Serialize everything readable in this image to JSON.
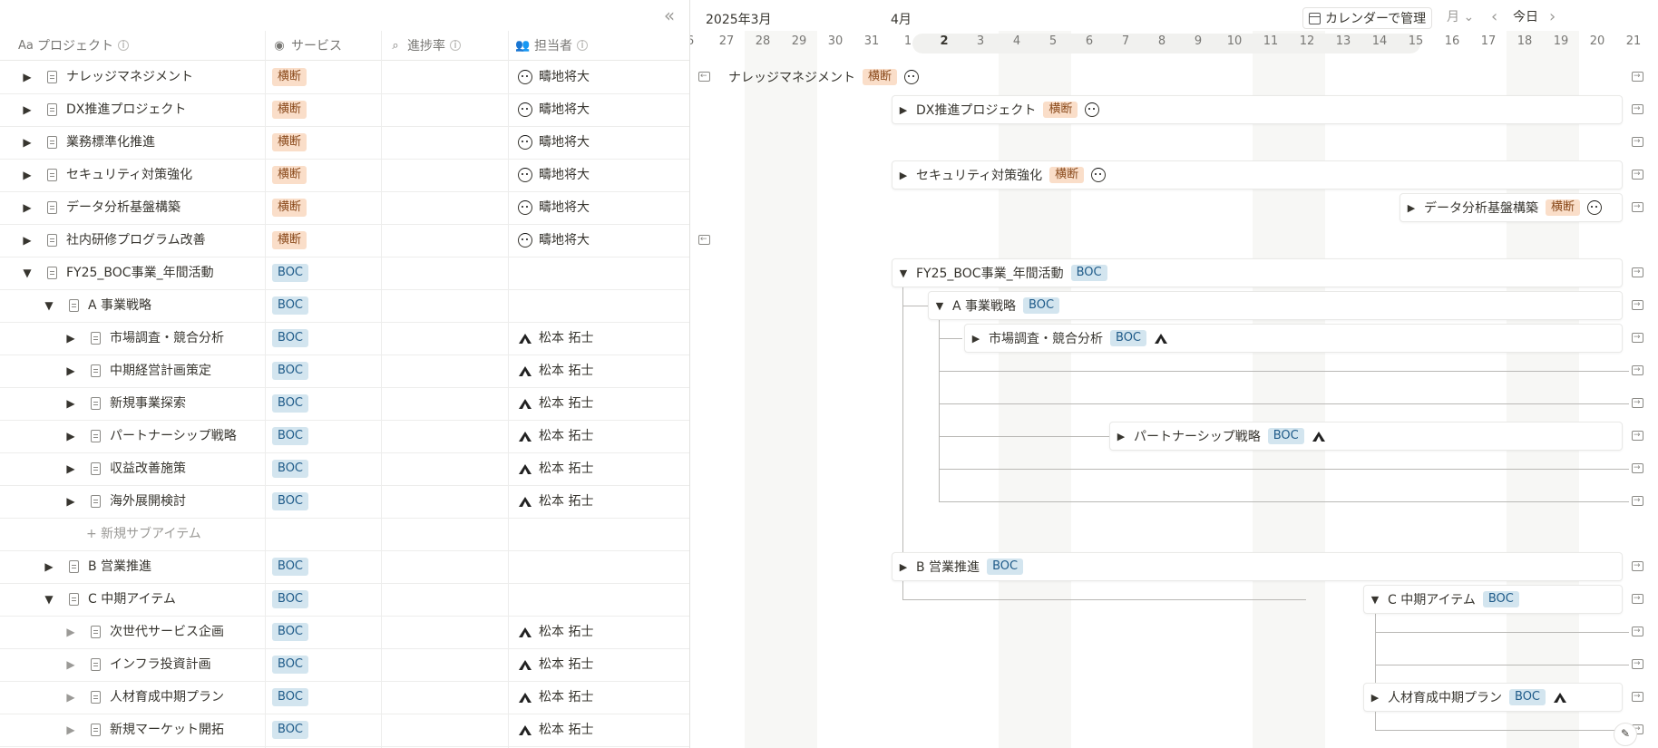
{
  "table": {
    "collapse_icon": "double-chevron-left-icon",
    "columns": [
      {
        "label": "プロジェクト",
        "icon": "Aa"
      },
      {
        "label": "サービス",
        "icon": "◉"
      },
      {
        "label": "進捗率",
        "icon": "⌕"
      },
      {
        "label": "担当者",
        "icon": "👥"
      }
    ],
    "rows": [
      {
        "title": "ナレッジマネジメント",
        "tag": "横断",
        "tag_type": "yokodan",
        "owner": "疇地将大",
        "avatar": "face",
        "depth": 0,
        "toggle": "▶"
      },
      {
        "title": "DX推進プロジェクト",
        "tag": "横断",
        "tag_type": "yokodan",
        "owner": "疇地将大",
        "avatar": "face",
        "depth": 0,
        "toggle": "▶"
      },
      {
        "title": "業務標準化推進",
        "tag": "横断",
        "tag_type": "yokodan",
        "owner": "疇地将大",
        "avatar": "face",
        "depth": 0,
        "toggle": "▶"
      },
      {
        "title": "セキュリティ対策強化",
        "tag": "横断",
        "tag_type": "yokodan",
        "owner": "疇地将大",
        "avatar": "face",
        "depth": 0,
        "toggle": "▶"
      },
      {
        "title": "データ分析基盤構築",
        "tag": "横断",
        "tag_type": "yokodan",
        "owner": "疇地将大",
        "avatar": "face",
        "depth": 0,
        "toggle": "▶"
      },
      {
        "title": "社内研修プログラム改善",
        "tag": "横断",
        "tag_type": "yokodan",
        "owner": "疇地将大",
        "avatar": "face",
        "depth": 0,
        "toggle": "▶"
      },
      {
        "title": "FY25_BOC事業_年間活動",
        "tag": "BOC",
        "tag_type": "boc",
        "owner": "",
        "avatar": "",
        "depth": 0,
        "toggle": "▼"
      },
      {
        "title": "A 事業戦略",
        "tag": "BOC",
        "tag_type": "boc",
        "owner": "",
        "avatar": "",
        "depth": 1,
        "toggle": "▼"
      },
      {
        "title": "市場調査・競合分析",
        "tag": "BOC",
        "tag_type": "boc",
        "owner": "松本 拓士",
        "avatar": "mtn",
        "depth": 2,
        "toggle": "▶"
      },
      {
        "title": "中期経営計画策定",
        "tag": "BOC",
        "tag_type": "boc",
        "owner": "松本 拓士",
        "avatar": "mtn",
        "depth": 2,
        "toggle": "▶"
      },
      {
        "title": "新規事業探索",
        "tag": "BOC",
        "tag_type": "boc",
        "owner": "松本 拓士",
        "avatar": "mtn",
        "depth": 2,
        "toggle": "▶"
      },
      {
        "title": "パートナーシップ戦略",
        "tag": "BOC",
        "tag_type": "boc",
        "owner": "松本 拓士",
        "avatar": "mtn",
        "depth": 2,
        "toggle": "▶"
      },
      {
        "title": "収益改善施策",
        "tag": "BOC",
        "tag_type": "boc",
        "owner": "松本 拓士",
        "avatar": "mtn",
        "depth": 2,
        "toggle": "▶"
      },
      {
        "title": "海外展開検討",
        "tag": "BOC",
        "tag_type": "boc",
        "owner": "松本 拓士",
        "avatar": "mtn",
        "depth": 2,
        "toggle": "▶"
      },
      {
        "new_sub": "+ 新規サブアイテム"
      },
      {
        "title": "B 営業推進",
        "tag": "BOC",
        "tag_type": "boc",
        "owner": "",
        "avatar": "",
        "depth": 1,
        "toggle": "▶"
      },
      {
        "title": "C 中期アイテム",
        "tag": "BOC",
        "tag_type": "boc",
        "owner": "",
        "avatar": "",
        "depth": 1,
        "toggle": "▼"
      },
      {
        "title": "次世代サービス企画",
        "tag": "BOC",
        "tag_type": "boc",
        "owner": "松本 拓士",
        "avatar": "mtn",
        "depth": 2,
        "toggle": "▶",
        "light": true
      },
      {
        "title": "インフラ投資計画",
        "tag": "BOC",
        "tag_type": "boc",
        "owner": "松本 拓士",
        "avatar": "mtn",
        "depth": 2,
        "toggle": "▶",
        "light": true
      },
      {
        "title": "人材育成中期プラン",
        "tag": "BOC",
        "tag_type": "boc",
        "owner": "松本 拓士",
        "avatar": "mtn",
        "depth": 2,
        "toggle": "▶",
        "light": true
      },
      {
        "title": "新規マーケット開拓",
        "tag": "BOC",
        "tag_type": "boc",
        "owner": "松本 拓士",
        "avatar": "mtn",
        "depth": 2,
        "toggle": "▶",
        "light": true
      }
    ]
  },
  "timeline": {
    "month_march": "2025年3月",
    "month_april": "4月",
    "calendar_button": "カレンダーで管理",
    "view_select": "月",
    "view_chevron": "⌄",
    "prev": "‹",
    "today": "今日",
    "next": "›",
    "days": [
      "6",
      "27",
      "28",
      "29",
      "30",
      "31",
      "1",
      "2",
      "3",
      "4",
      "5",
      "6",
      "7",
      "8",
      "9",
      "10",
      "11",
      "12",
      "13",
      "14",
      "15",
      "16",
      "17",
      "18",
      "19",
      "20",
      "21"
    ],
    "today_day": "2",
    "bars": [
      {
        "row": 0,
        "title": "ナレッジマネジメント",
        "tag": "横断",
        "tag_type": "yokodan",
        "avatar": "face",
        "card": false
      },
      {
        "row": 1,
        "title": "DX推進プロジェクト",
        "tag": "横断",
        "tag_type": "yokodan",
        "avatar": "face",
        "card": true,
        "toggle": "▶"
      },
      {
        "row": 3,
        "title": "セキュリティ対策強化",
        "tag": "横断",
        "tag_type": "yokodan",
        "avatar": "face",
        "card": true,
        "toggle": "▶"
      },
      {
        "row": 4,
        "title": "データ分析基盤構築",
        "tag": "横断",
        "tag_type": "yokodan",
        "avatar": "face",
        "card": true,
        "toggle": "▶"
      },
      {
        "row": 6,
        "title": "FY25_BOC事業_年間活動",
        "tag": "BOC",
        "tag_type": "boc",
        "avatar": "",
        "card": true,
        "toggle": "▼"
      },
      {
        "row": 7,
        "title": "A 事業戦略",
        "tag": "BOC",
        "tag_type": "boc",
        "avatar": "",
        "card": true,
        "toggle": "▼"
      },
      {
        "row": 8,
        "title": "市場調査・競合分析",
        "tag": "BOC",
        "tag_type": "boc",
        "avatar": "mtn",
        "card": true,
        "toggle": "▶"
      },
      {
        "row": 11,
        "title": "パートナーシップ戦略",
        "tag": "BOC",
        "tag_type": "boc",
        "avatar": "mtn",
        "card": true,
        "toggle": "▶"
      },
      {
        "row": 15,
        "title": "B 営業推進",
        "tag": "BOC",
        "tag_type": "boc",
        "avatar": "",
        "card": true,
        "toggle": "▶"
      },
      {
        "row": 16,
        "title": "C 中期アイテム",
        "tag": "BOC",
        "tag_type": "boc",
        "avatar": "",
        "card": true,
        "toggle": "▼"
      },
      {
        "row": 19,
        "title": "人材育成中期プラン",
        "tag": "BOC",
        "tag_type": "boc",
        "avatar": "mtn",
        "card": true,
        "toggle": "▶"
      }
    ],
    "corner_icon": "feather-icon"
  }
}
